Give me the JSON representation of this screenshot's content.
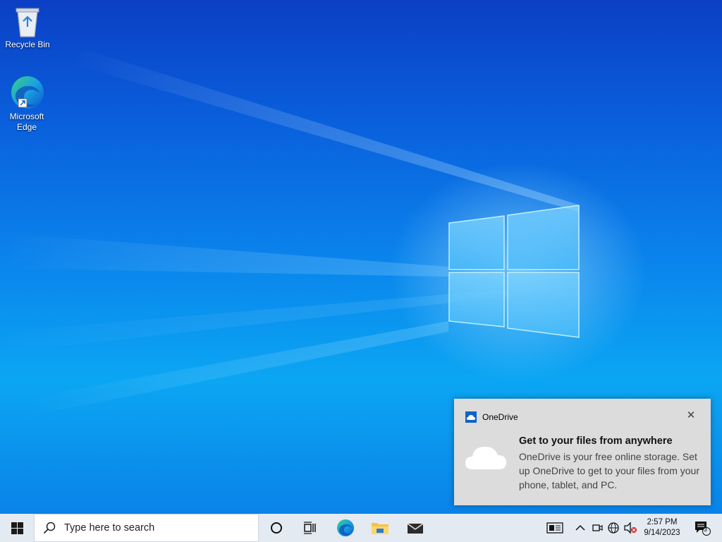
{
  "desktop": {
    "icons": [
      {
        "label": "Recycle Bin",
        "icon": "recycle-bin-icon"
      },
      {
        "label": "Microsoft Edge",
        "icon": "edge-icon"
      }
    ]
  },
  "toast": {
    "app_name": "OneDrive",
    "close_glyph": "✕",
    "title": "Get to your files from anywhere",
    "body": "OneDrive is your free online storage. Set up OneDrive to get to your files from your phone, tablet, and PC."
  },
  "taskbar": {
    "search_placeholder": "Type here to search",
    "pinned": [
      "cortana-icon",
      "task-view-icon",
      "edge-icon",
      "file-explorer-icon",
      "mail-icon"
    ],
    "time": "2:57 PM",
    "date": "9/14/2023",
    "notification_count": "3",
    "accent": "#0078d4"
  }
}
